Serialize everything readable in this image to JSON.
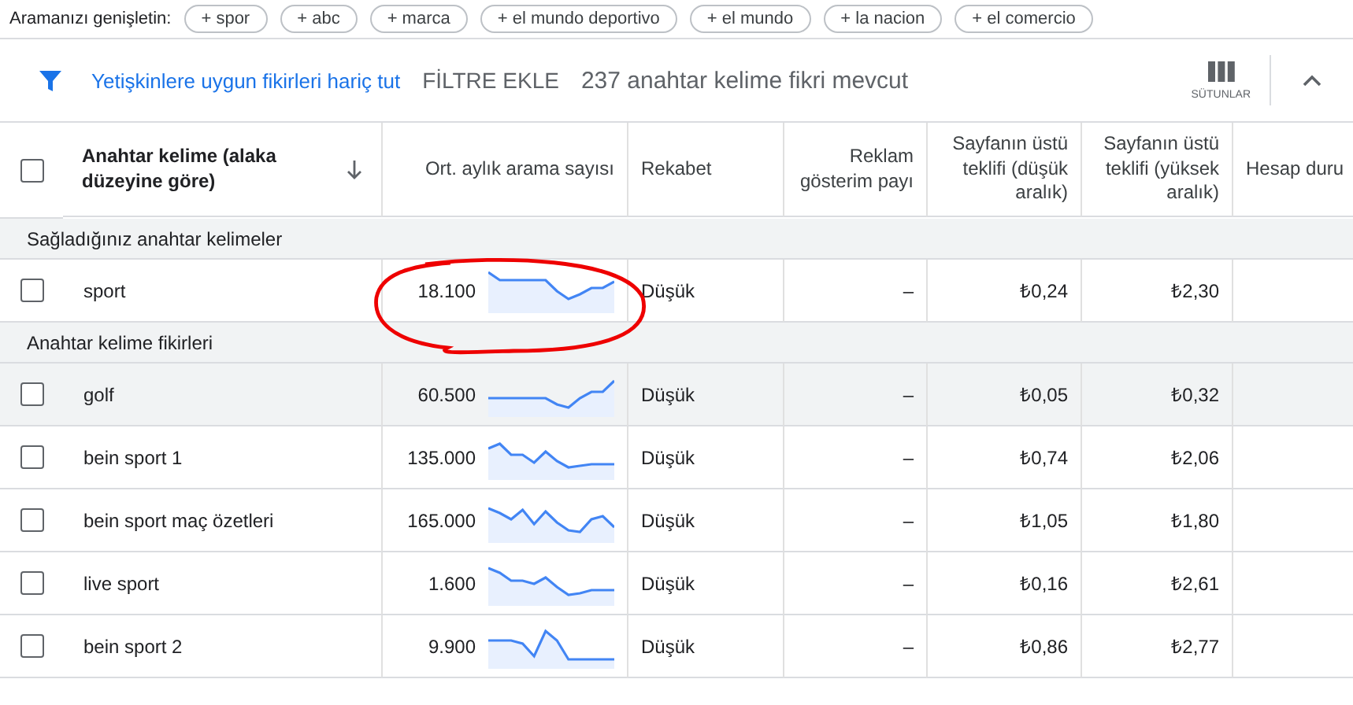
{
  "expand_bar": {
    "label": "Aramanızı genişletin:",
    "chips": [
      "+ spor",
      "+ abc",
      "+ marca",
      "+ el mundo deportivo",
      "+ el mundo",
      "+ la nacion",
      "+ el comercio"
    ]
  },
  "filter_bar": {
    "adult_filter": "Yetişkinlere uygun fikirleri hariç tut",
    "add_filter": "FİLTRE EKLE",
    "count": "237 anahtar kelime fikri mevcut",
    "columns_button": "SÜTUNLAR",
    "collapsed": false
  },
  "table": {
    "select_all_checked": false,
    "columns": [
      "Anahtar kelime (alaka düzeyine göre)",
      "Ort. aylık arama sayısı",
      "Rekabet",
      "Reklam gösterim payı",
      "Sayfanın üstü teklifi (düşük aralık)",
      "Sayfanın üstü teklifi (yüksek aralık)",
      "Hesap duru"
    ],
    "groups": [
      {
        "title": "Sağladığınız anahtar kelimeler",
        "rows": [
          {
            "keyword": "sport",
            "searches": "18.100",
            "competition": "Düşük",
            "impression_share": "–",
            "bid_low": "₺0,24",
            "bid_high": "₺2,30",
            "checked": false,
            "highlighted": false
          }
        ]
      },
      {
        "title": "Anahtar kelime fikirleri",
        "rows": [
          {
            "keyword": "golf",
            "searches": "60.500",
            "competition": "Düşük",
            "impression_share": "–",
            "bid_low": "₺0,05",
            "bid_high": "₺0,32",
            "checked": false,
            "highlighted": true
          },
          {
            "keyword": "bein sport 1",
            "searches": "135.000",
            "competition": "Düşük",
            "impression_share": "–",
            "bid_low": "₺0,74",
            "bid_high": "₺2,06",
            "checked": false,
            "highlighted": false
          },
          {
            "keyword": "bein sport maç özetleri",
            "searches": "165.000",
            "competition": "Düşük",
            "impression_share": "–",
            "bid_low": "₺1,05",
            "bid_high": "₺1,80",
            "checked": false,
            "highlighted": false
          },
          {
            "keyword": "live sport",
            "searches": "1.600",
            "competition": "Düşük",
            "impression_share": "–",
            "bid_low": "₺0,16",
            "bid_high": "₺2,61",
            "checked": false,
            "highlighted": false
          },
          {
            "keyword": "bein sport 2",
            "searches": "9.900",
            "competition": "Düşük",
            "impression_share": "–",
            "bid_low": "₺0,86",
            "bid_high": "₺2,77",
            "checked": false,
            "highlighted": false
          }
        ]
      }
    ]
  }
}
